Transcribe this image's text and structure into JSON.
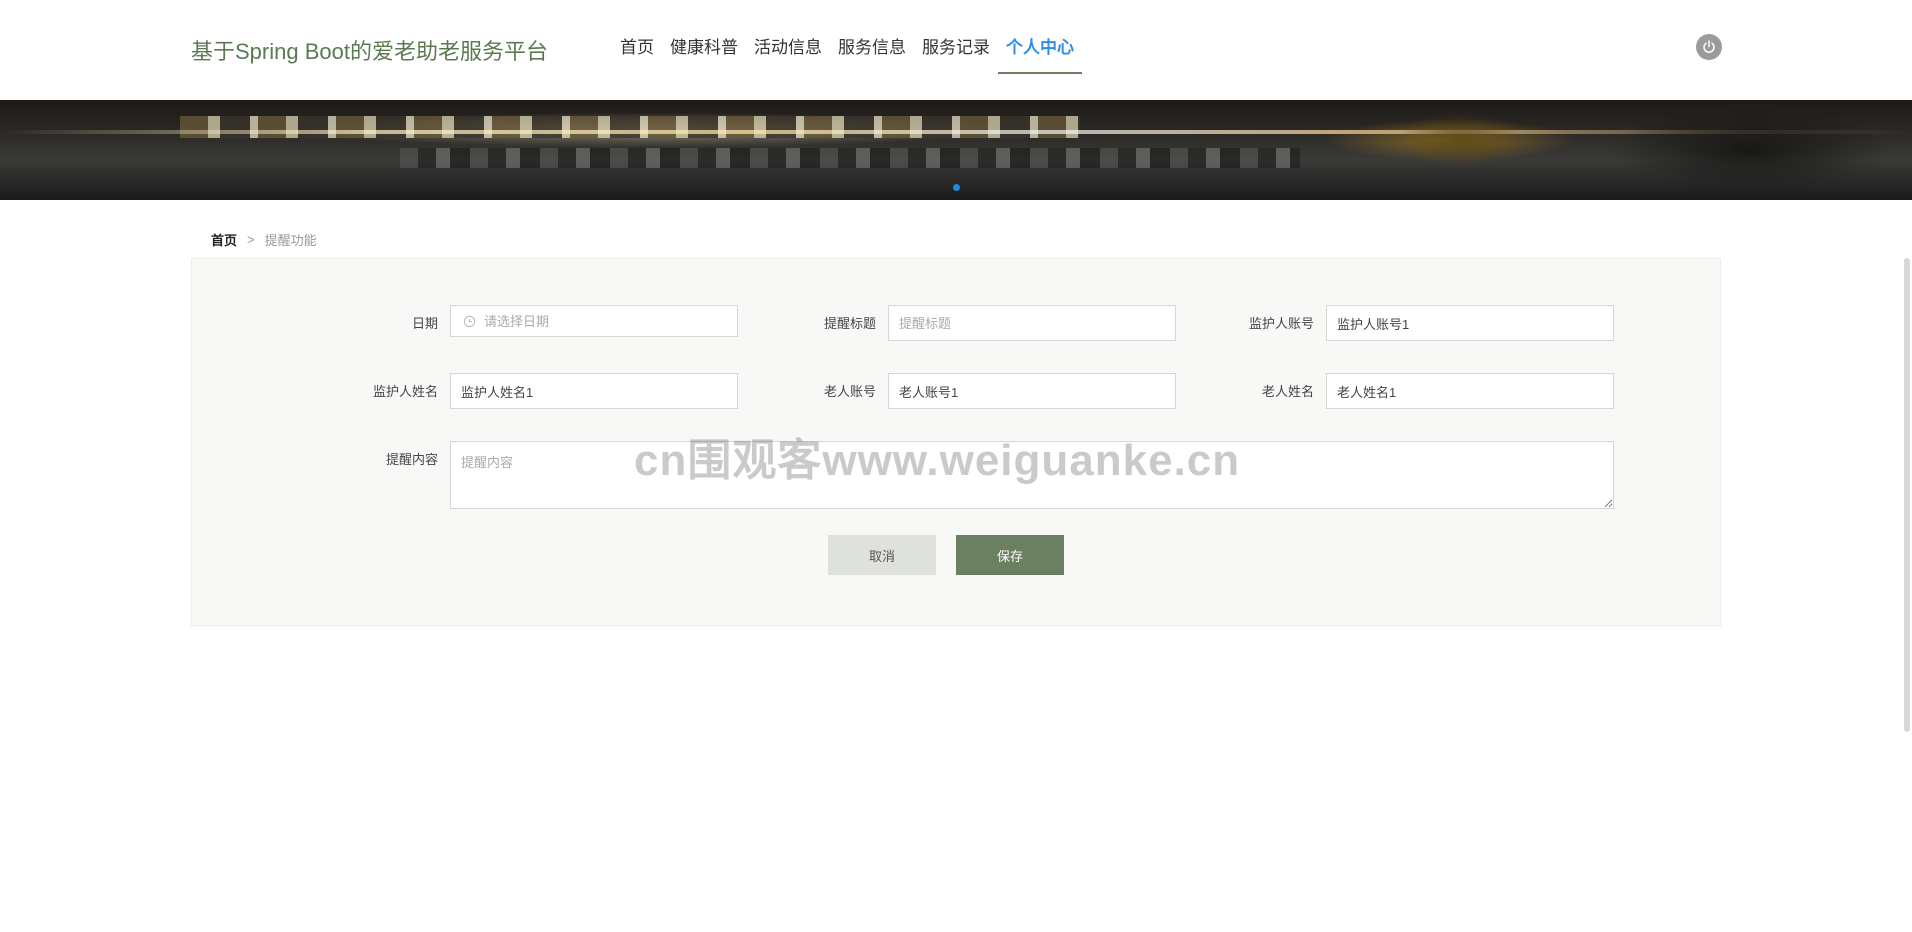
{
  "header": {
    "site_title": "基于Spring Boot的爱老助老服务平台",
    "nav": [
      {
        "label": "首页",
        "active": false
      },
      {
        "label": "健康科普",
        "active": false
      },
      {
        "label": "活动信息",
        "active": false
      },
      {
        "label": "服务信息",
        "active": false
      },
      {
        "label": "服务记录",
        "active": false
      },
      {
        "label": "个人中心",
        "active": true
      }
    ],
    "power_icon": "power-icon"
  },
  "colors": {
    "brand": "#5c7a52",
    "accent": "#2f8ee8",
    "save_button": "#6b7f61",
    "cancel_button": "#dfe2dc"
  },
  "breadcrumb": {
    "home": "首页",
    "separator": ">",
    "current": "提醒功能"
  },
  "form": {
    "date": {
      "label": "日期",
      "placeholder": "请选择日期",
      "value": ""
    },
    "title": {
      "label": "提醒标题",
      "placeholder": "提醒标题",
      "value": ""
    },
    "guardian_account": {
      "label": "监护人账号",
      "value": "监护人账号1"
    },
    "guardian_name": {
      "label": "监护人姓名",
      "value": "监护人姓名1"
    },
    "elder_account": {
      "label": "老人账号",
      "value": "老人账号1"
    },
    "elder_name": {
      "label": "老人姓名",
      "value": "老人姓名1"
    },
    "content": {
      "label": "提醒内容",
      "placeholder": "提醒内容",
      "value": ""
    },
    "cancel_label": "取消",
    "save_label": "保存"
  },
  "watermark": "cn围观客www.weiguanke.cn"
}
